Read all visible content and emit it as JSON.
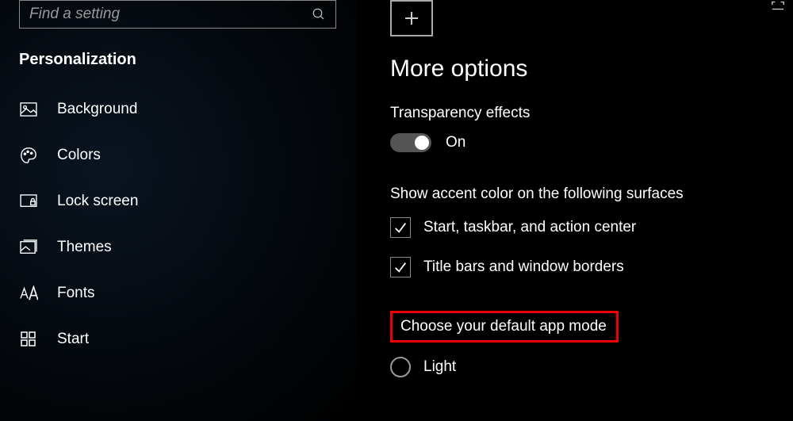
{
  "search": {
    "placeholder": "Find a setting"
  },
  "section": {
    "title": "Personalization"
  },
  "nav": {
    "items": [
      {
        "label": "Background"
      },
      {
        "label": "Colors"
      },
      {
        "label": "Lock screen"
      },
      {
        "label": "Themes"
      },
      {
        "label": "Fonts"
      },
      {
        "label": "Start"
      }
    ]
  },
  "main": {
    "heading": "More options",
    "transparency": {
      "label": "Transparency effects",
      "state": "On"
    },
    "accent": {
      "label": "Show accent color on the following surfaces",
      "opt1": "Start, taskbar, and action center",
      "opt2": "Title bars and window borders"
    },
    "appmode": {
      "label": "Choose your default app mode",
      "opt_light": "Light"
    }
  }
}
